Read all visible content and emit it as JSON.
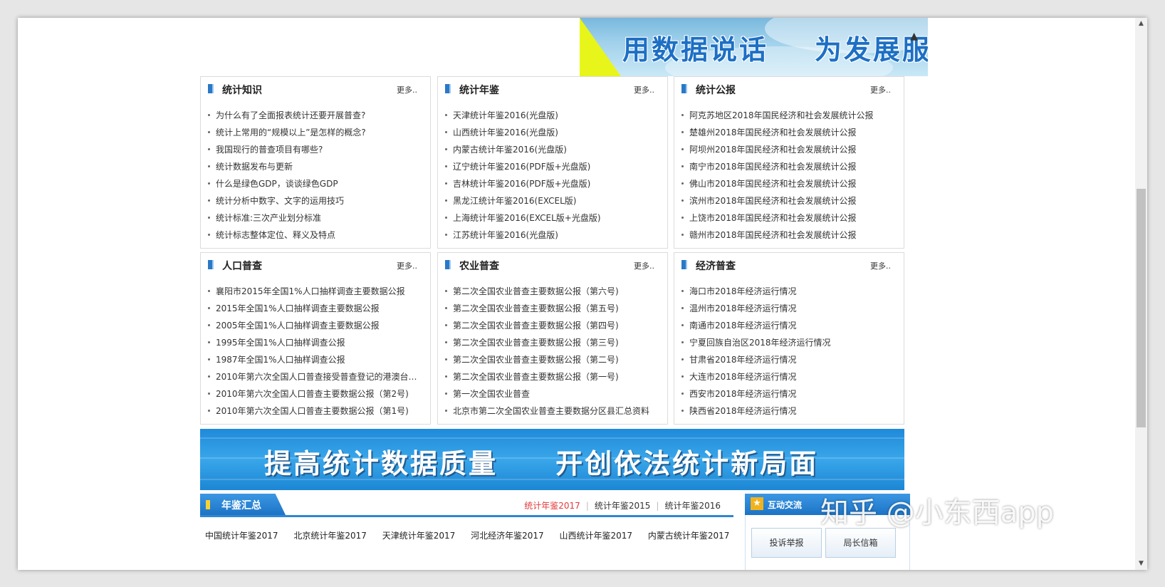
{
  "top_banner": {
    "slogan": "用数据说话    为发展服务"
  },
  "boxes": [
    {
      "title": "统计知识",
      "more": "更多..",
      "items": [
        "为什么有了全面报表统计还要开展普查?",
        "统计上常用的“规模以上”是怎样的概念?",
        "我国现行的普查项目有哪些?",
        "统计数据发布与更新",
        "什么是绿色GDP，谈谈绿色GDP",
        "统计分析中数字、文字的运用技巧",
        "统计标准:三次产业划分标准",
        "统计标志整体定位、释义及特点"
      ]
    },
    {
      "title": "统计年鉴",
      "more": "更多..",
      "items": [
        "天津统计年鉴2016(光盘版)",
        "山西统计年鉴2016(光盘版)",
        "内蒙古统计年鉴2016(光盘版)",
        "辽宁统计年鉴2016(PDF版+光盘版)",
        "吉林统计年鉴2016(PDF版+光盘版)",
        "黑龙江统计年鉴2016(EXCEL版)",
        "上海统计年鉴2016(EXCEL版+光盘版)",
        "江苏统计年鉴2016(光盘版)"
      ]
    },
    {
      "title": "统计公报",
      "more": "更多..",
      "items": [
        "阿克苏地区2018年国民经济和社会发展统计公报",
        "楚雄州2018年国民经济和社会发展统计公报",
        "阿坝州2018年国民经济和社会发展统计公报",
        "南宁市2018年国民经济和社会发展统计公报",
        "佛山市2018年国民经济和社会发展统计公报",
        "滨州市2018年国民经济和社会发展统计公报",
        "上饶市2018年国民经济和社会发展统计公报",
        "赣州市2018年国民经济和社会发展统计公报"
      ]
    },
    {
      "title": "人口普查",
      "more": "更多..",
      "items": [
        "襄阳市2015年全国1%人口抽样调查主要数据公报",
        "2015年全国1%人口抽样调查主要数据公报",
        "2005年全国1%人口抽样调查主要数据公报",
        "1995年全国1%人口抽样调查公报",
        "1987年全国1%人口抽样调查公报",
        "2010年第六次全国人口普查接受普查登记的港澳台居...",
        "2010年第六次全国人口普查主要数据公报（第2号)",
        "2010年第六次全国人口普查主要数据公报（第1号)"
      ]
    },
    {
      "title": "农业普查",
      "more": "更多..",
      "items": [
        "第二次全国农业普查主要数据公报（第六号)",
        "第二次全国农业普查主要数据公报（第五号)",
        "第二次全国农业普查主要数据公报（第四号)",
        "第二次全国农业普查主要数据公报（第三号)",
        "第二次全国农业普查主要数据公报（第二号)",
        "第二次全国农业普查主要数据公报（第一号)",
        "第一次全国农业普查",
        "北京市第二次全国农业普查主要数据分区县汇总资料"
      ]
    },
    {
      "title": "经济普查",
      "more": "更多..",
      "items": [
        "海口市2018年经济运行情况",
        "温州市2018年经济运行情况",
        "南通市2018年经济运行情况",
        "宁夏回族自治区2018年经济运行情况",
        "甘肃省2018年经济运行情况",
        "大连市2018年经济运行情况",
        "西安市2018年经济运行情况",
        "陕西省2018年经济运行情况"
      ]
    }
  ],
  "mid_banner": {
    "slogan": "提高统计数据质量     开创依法统计新局面"
  },
  "yearbook": {
    "title": "年鉴汇总",
    "links": [
      "统计年鉴2017",
      "统计年鉴2015",
      "统计年鉴2016"
    ],
    "items": [
      "中国统计年鉴2017",
      "北京统计年鉴2017",
      "天津统计年鉴2017",
      "河北经济年鉴2017",
      "山西统计年鉴2017",
      "内蒙古统计年鉴2017"
    ]
  },
  "interaction": {
    "title": "互动交流",
    "buttons": [
      "投诉举报",
      "局长信箱"
    ]
  },
  "watermark": "知乎 @小东西app",
  "colors": {
    "accent_blue": "#2a78c8",
    "active_link": "#e03b3b",
    "banner_blue": "#1f8ad9"
  },
  "icons": {
    "scroll_up": "▲",
    "scroll_down": "▼",
    "star": "★"
  }
}
